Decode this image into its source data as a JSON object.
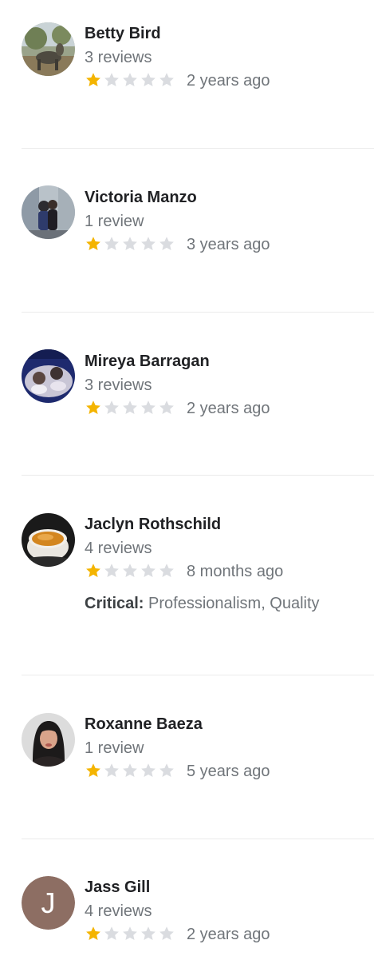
{
  "reviews": [
    {
      "name": "Betty Bird",
      "count": "3 reviews",
      "rating": 1,
      "max_rating": 5,
      "date": "2 years ago",
      "avatar": "photo"
    },
    {
      "name": "Victoria Manzo",
      "count": "1 review",
      "rating": 1,
      "max_rating": 5,
      "date": "3 years ago",
      "avatar": "photo"
    },
    {
      "name": "Mireya Barragan",
      "count": "3 reviews",
      "rating": 1,
      "max_rating": 5,
      "date": "2 years ago",
      "avatar": "photo"
    },
    {
      "name": "Jaclyn Rothschild",
      "count": "4 reviews",
      "rating": 1,
      "max_rating": 5,
      "date": "8 months ago",
      "avatar": "photo",
      "critical_label": "Critical:",
      "critical_text": " Professionalism, Quality"
    },
    {
      "name": "Roxanne Baeza",
      "count": "1 review",
      "rating": 1,
      "max_rating": 5,
      "date": "5 years ago",
      "avatar": "photo"
    },
    {
      "name": "Jass Gill",
      "count": "4 reviews",
      "rating": 1,
      "max_rating": 5,
      "date": "2 years ago",
      "avatar": "letter",
      "avatar_letter": "J"
    }
  ],
  "colors": {
    "star_filled": "#f4b400",
    "star_empty": "#dadce0",
    "letter_avatar_bg": "#8d6e63"
  }
}
